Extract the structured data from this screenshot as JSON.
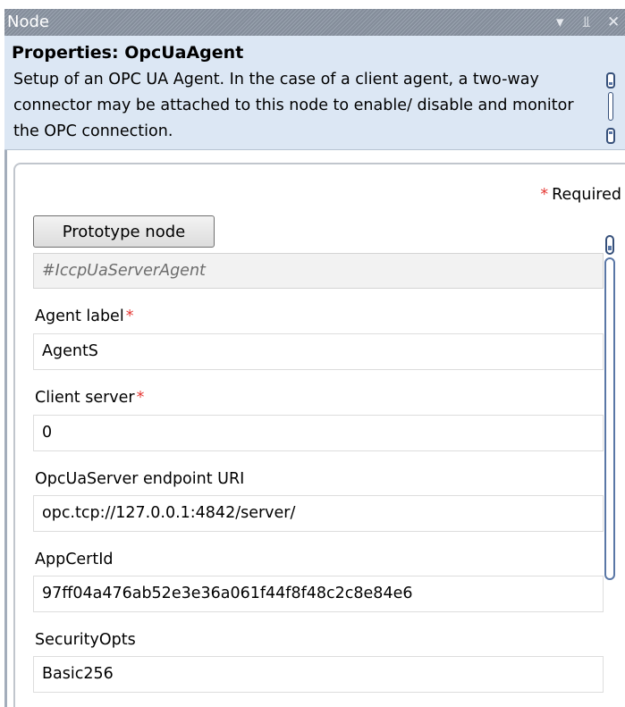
{
  "window": {
    "title": "Node",
    "controls": {
      "dropdown": "▾",
      "pin": "⫫",
      "close": "✕"
    }
  },
  "header": {
    "title": "Properties:  OpcUaAgent",
    "description": "Setup of an OPC UA Agent. In the case of a client agent, a two-way connector may be attached to this node to enable/ disable and monitor the OPC connection."
  },
  "form": {
    "required_note": "Required",
    "required_marker": "*",
    "prototype": {
      "button_label": "Prototype node",
      "value": "#IccpUaServerAgent"
    },
    "fields": [
      {
        "label": "Agent label",
        "required": true,
        "value": "AgentS"
      },
      {
        "label": "Client server",
        "required": true,
        "value": "0"
      },
      {
        "label": "OpcUaServer endpoint URI",
        "required": false,
        "value": "opc.tcp://127.0.0.1:4842/server/"
      },
      {
        "label": "AppCertId",
        "required": false,
        "value": "97ff04a476ab52e3e36a061f44f8f48c2c8e84e6"
      },
      {
        "label": "SecurityOpts",
        "required": false,
        "value": "Basic256"
      }
    ]
  },
  "colors": {
    "header_bg": "#dce7f4",
    "required_star": "#e53935",
    "scrollbar": "#36507a"
  }
}
